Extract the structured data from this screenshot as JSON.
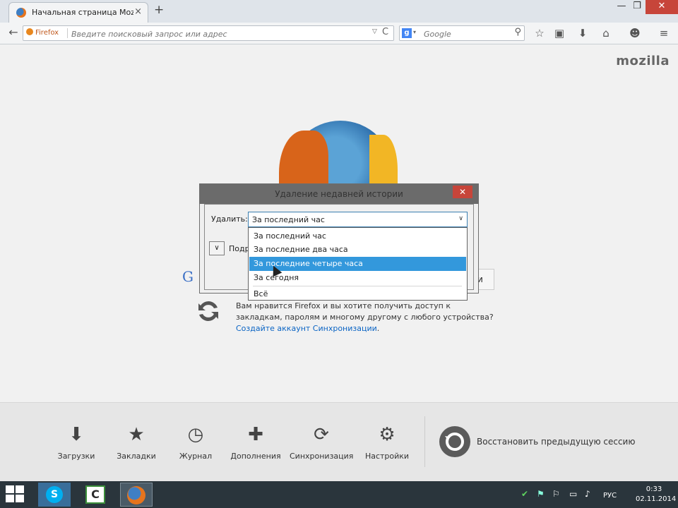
{
  "browser": {
    "tab_title": "Начальная страница Mozi...",
    "tab_close": "×",
    "new_tab": "+",
    "window_controls": {
      "minimize": "—",
      "restore": "❐",
      "close": "✕"
    }
  },
  "navbar": {
    "back": "←",
    "identity_label": "Firefox",
    "url_placeholder": "Введите поисковый запрос или адрес",
    "url_dropmarker": "▽",
    "reload": "C",
    "search_engine_icon": "g",
    "search_engine_drop": "▾",
    "search_placeholder": "Google",
    "search_go": "⚲",
    "toolbar_icons": [
      "star-icon",
      "reading-list-icon",
      "download-icon",
      "home-icon",
      "social-icon",
      "menu-icon"
    ],
    "toolbar_glyphs": {
      "bookmark": "☆",
      "library": "▣",
      "download": "⬇",
      "home": "⌂",
      "social": "☻",
      "menu": "≡"
    }
  },
  "content": {
    "brand": "mozilla",
    "google_fragment": "G",
    "search_button_fragment": "и",
    "sync_text": "Вам нравится Firefox и вы хотите получить доступ к закладкам, паролям и многому другому с любого устройства? ",
    "sync_link": "Создайте аккаунт Синхронизации",
    "sync_period": "."
  },
  "dialog": {
    "title": "Удаление недавней истории",
    "close": "✕",
    "range_label": "Удалить:",
    "range_value": "За последний час",
    "range_arrow": "∨",
    "details_toggle": "∨",
    "details_label": "Подр",
    "options": [
      {
        "label": "За последний час",
        "selected": false
      },
      {
        "label": "За последние два часа",
        "selected": false
      },
      {
        "label": "За последние четыре часа",
        "selected": true
      },
      {
        "label": "За сегодня",
        "selected": false
      },
      {
        "label": "Всё",
        "selected": false
      }
    ]
  },
  "launcher": {
    "items": [
      {
        "label": "Загрузки",
        "icon": "download-icon",
        "glyph": "⬇"
      },
      {
        "label": "Закладки",
        "icon": "star-icon",
        "glyph": "★"
      },
      {
        "label": "Журнал",
        "icon": "clock-icon",
        "glyph": "◷"
      },
      {
        "label": "Дополнения",
        "icon": "puzzle-icon",
        "glyph": "✚"
      },
      {
        "label": "Синхронизация",
        "icon": "sync-icon",
        "glyph": "⟳"
      },
      {
        "label": "Настройки",
        "icon": "gear-icon",
        "glyph": "⚙"
      }
    ],
    "restore_label": "Восстановить предыдущую сессию"
  },
  "taskbar": {
    "apps": [
      "skype-icon",
      "camtasia-icon",
      "firefox-icon"
    ],
    "skype_glyph": "S",
    "camtasia_glyph": "C",
    "tray_glyphs": [
      "✔",
      "⚑",
      "⚐",
      "▭",
      "♪"
    ],
    "language": "РУС",
    "time": "0:33",
    "date": "02.11.2014"
  },
  "colors": {
    "selection": "#3398dc",
    "dialog_close": "#c7453a",
    "taskbar": "#2a353c",
    "link": "#0a64c4"
  }
}
